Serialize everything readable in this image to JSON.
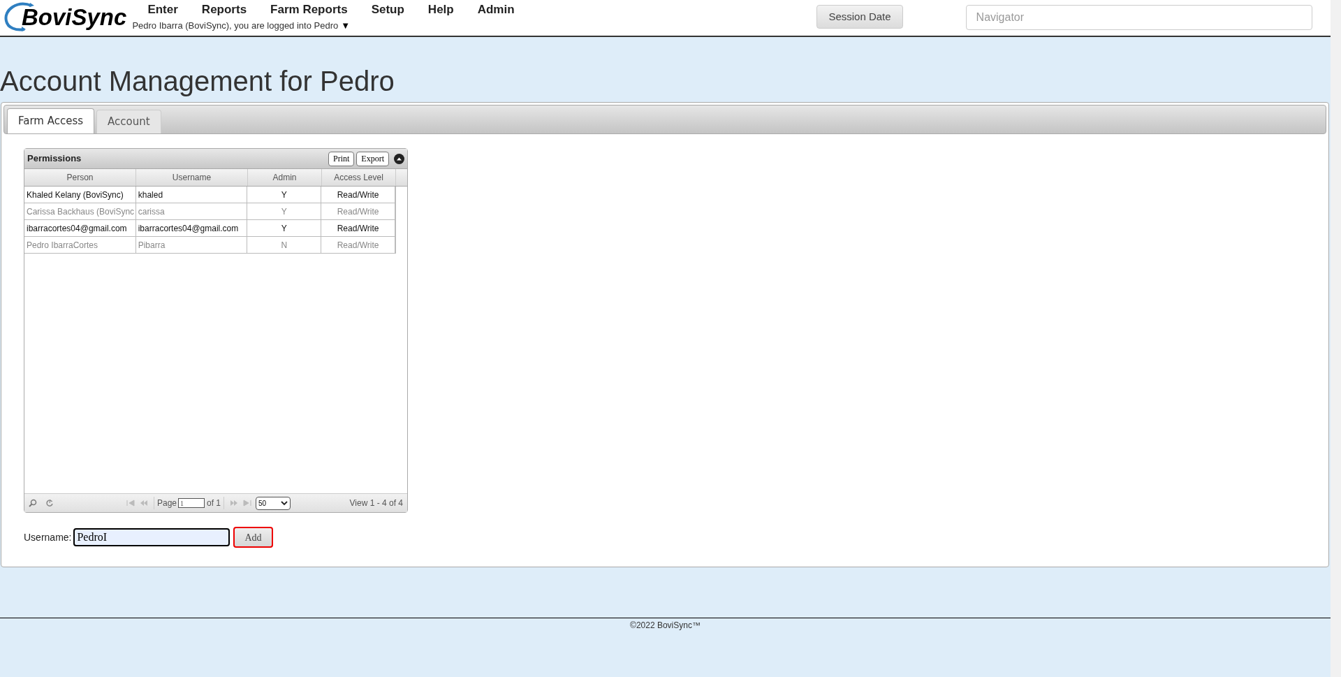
{
  "header": {
    "logo": "BoviSync",
    "menu": [
      "Enter",
      "Reports",
      "Farm Reports",
      "Setup",
      "Help",
      "Admin"
    ],
    "login_text": "Pedro Ibarra (BoviSync), you are logged into Pedro",
    "login_caret": "▼",
    "session_button": "Session Date",
    "navigator": {
      "placeholder": "Navigator"
    }
  },
  "title": "Account Management for Pedro",
  "tabs": [
    {
      "label": "Farm Access",
      "selected": true
    },
    {
      "label": "Account",
      "selected": false
    }
  ],
  "grid": {
    "title": "Permissions",
    "buttons": [
      "Print",
      "Export"
    ],
    "columns": [
      "Person",
      "Username",
      "Admin",
      "Access Level"
    ],
    "rows": [
      {
        "cells": [
          "Khaled Kelany (BoviSync)",
          "khaled",
          "Y",
          "Read/Write"
        ],
        "disabled": false
      },
      {
        "cells": [
          "Carissa Backhaus (BoviSync",
          "carissa",
          "Y",
          "Read/Write"
        ],
        "disabled": true
      },
      {
        "cells": [
          "ibarracortes04@gmail.com",
          "ibarracortes04@gmail.com",
          "Y",
          "Read/Write"
        ],
        "disabled": false
      },
      {
        "cells": [
          "Pedro IbarraCortes",
          "Pibarra",
          "N",
          "Read/Write"
        ],
        "disabled": true
      }
    ],
    "pager": {
      "page_label": "Page",
      "page": "1",
      "of_label": "of 1",
      "page_size": "50",
      "view_text": "View 1 - 4 of 4"
    }
  },
  "add_form": {
    "label": "Username:",
    "value": "PedroI",
    "button": "Add"
  },
  "footer": "©2022 BoviSync™"
}
